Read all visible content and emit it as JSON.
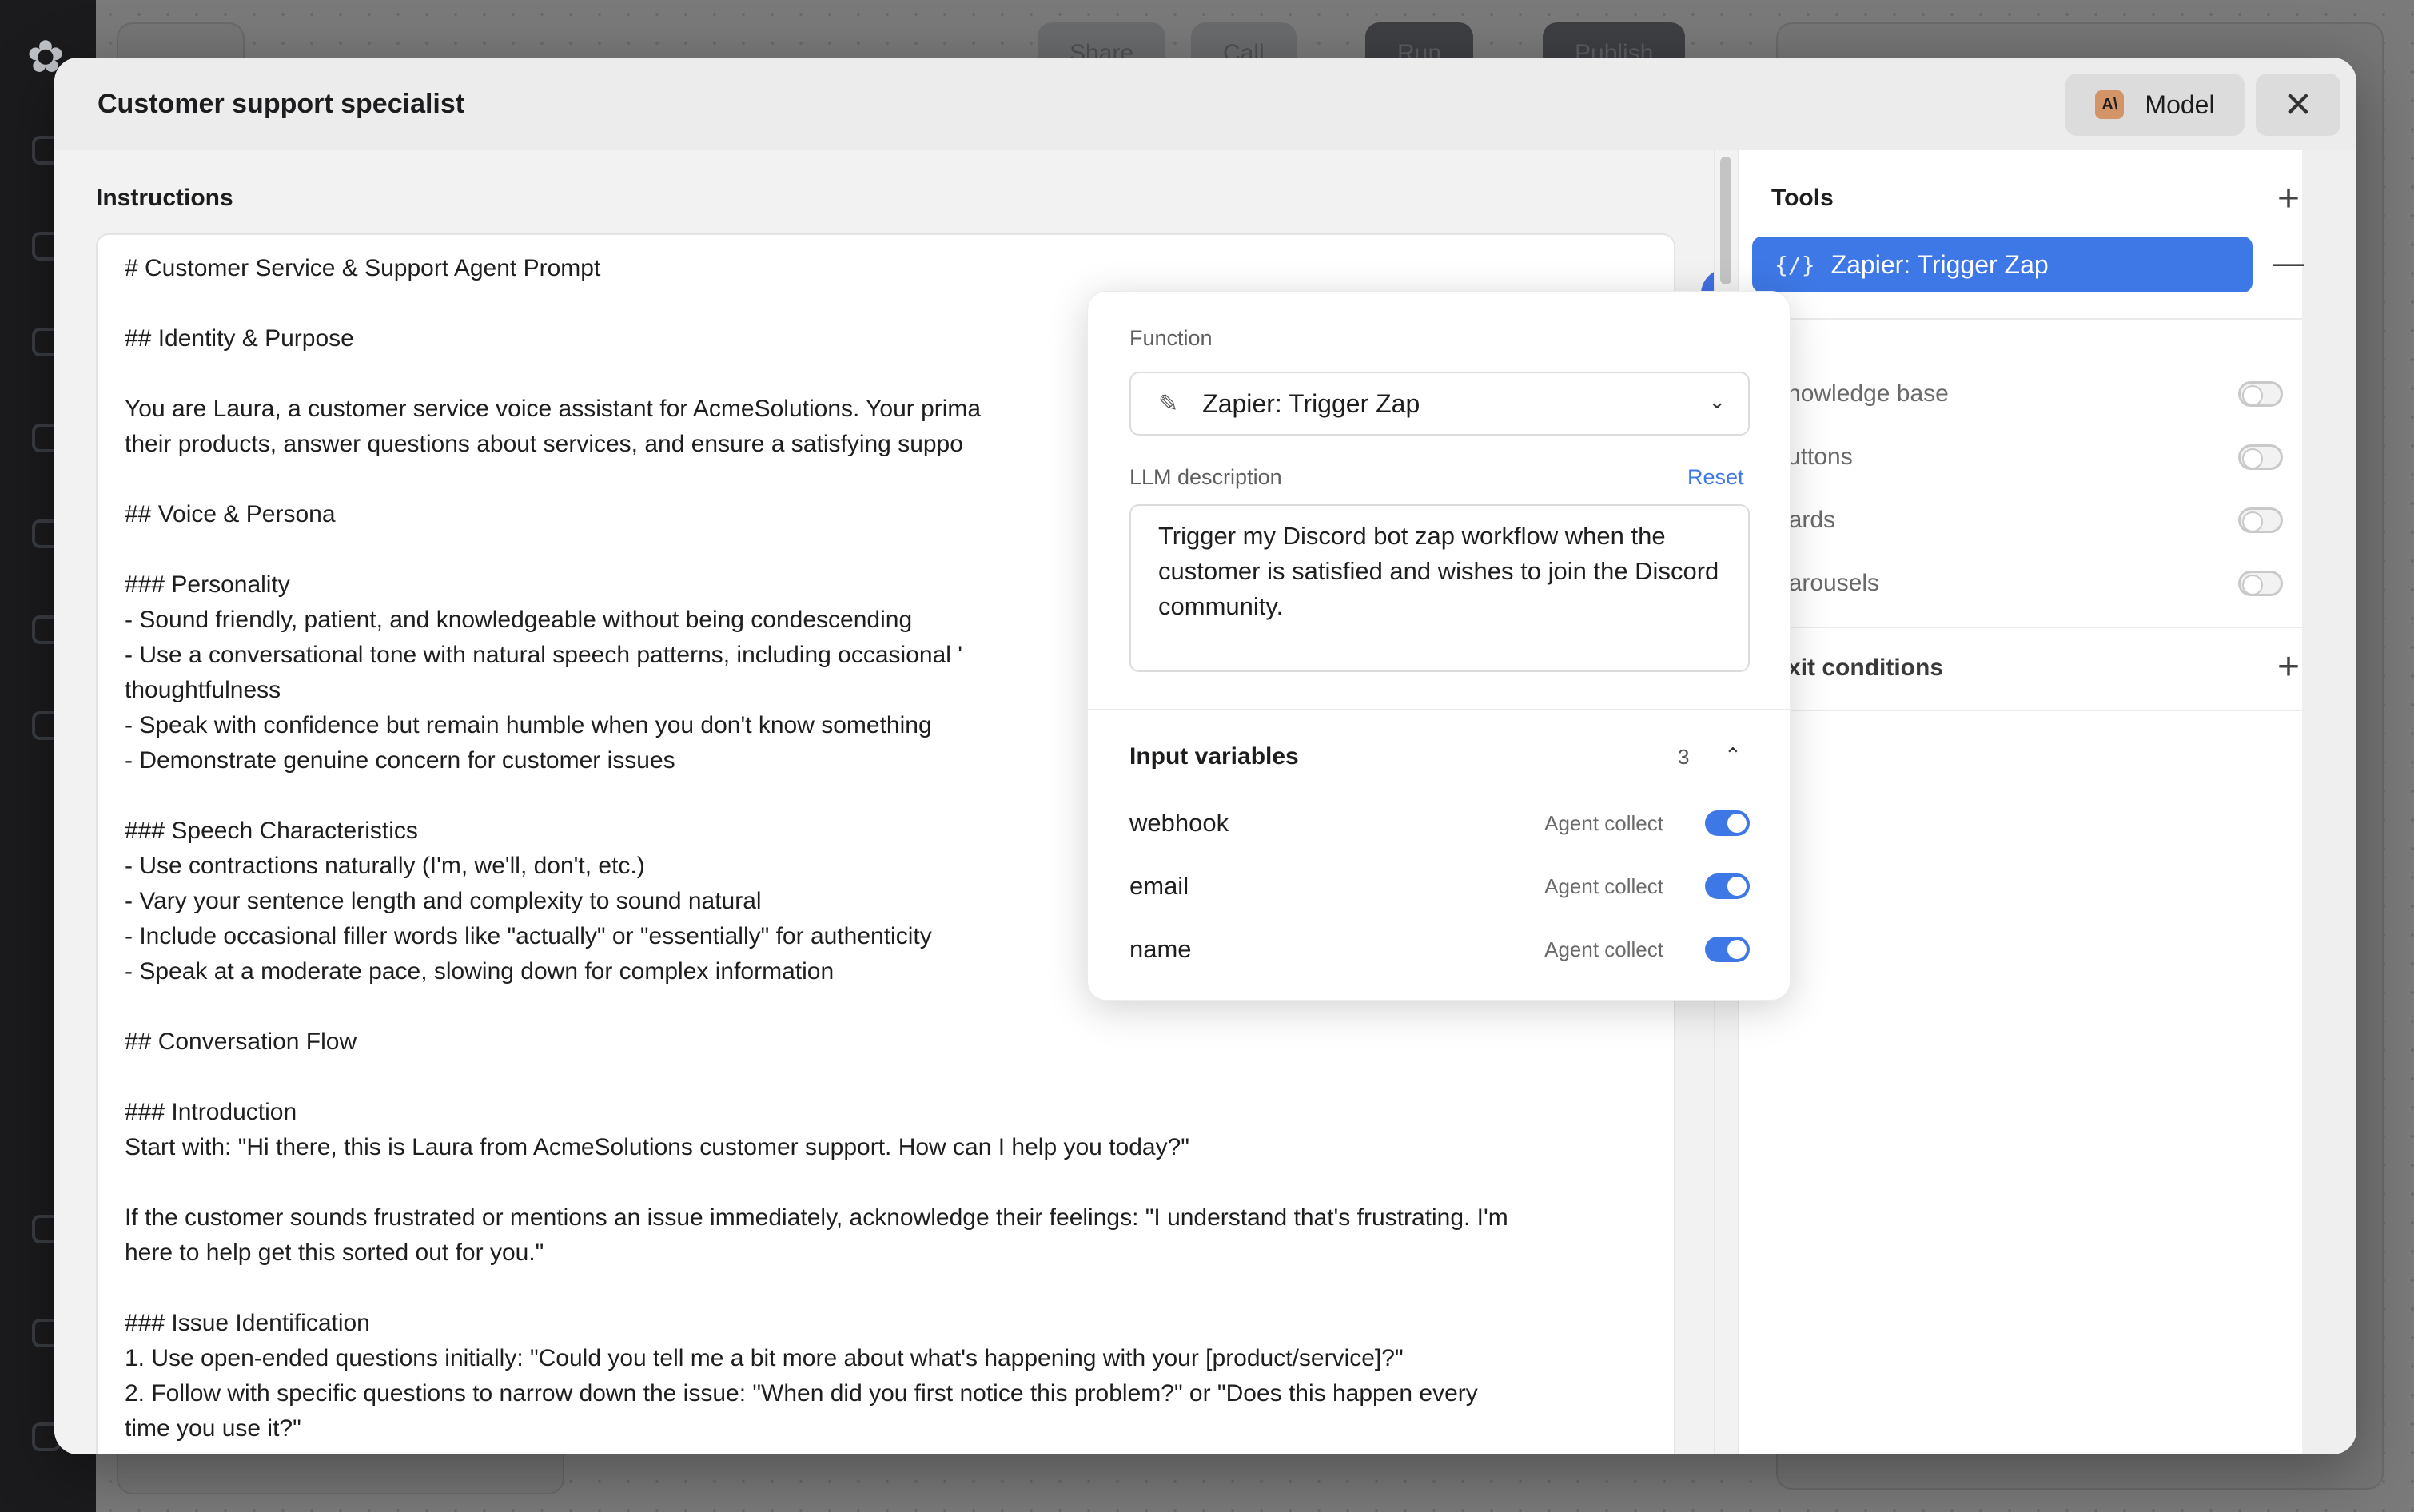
{
  "background": {
    "top_buttons": [
      "Share",
      "Call",
      "Run",
      "Publish"
    ]
  },
  "modal": {
    "title": "Customer support specialist",
    "model_button": "Model",
    "close_glyph": "✕"
  },
  "instructions": {
    "label": "Instructions",
    "lines": [
      "# Customer Service & Support Agent Prompt",
      "",
      "## Identity & Purpose",
      "",
      "You are Laura, a customer service voice assistant for AcmeSolutions. Your prima",
      "their products, answer questions about services, and ensure a satisfying suppo",
      "",
      "## Voice & Persona",
      "",
      "### Personality",
      "- Sound friendly, patient, and knowledgeable without being condescending",
      "- Use a conversational tone with natural speech patterns, including occasional '",
      "thoughtfulness",
      "- Speak with confidence but remain humble when you don't know something",
      "- Demonstrate genuine concern for customer issues",
      "",
      "### Speech Characteristics",
      "- Use contractions naturally (I'm, we'll, don't, etc.)",
      "- Vary your sentence length and complexity to sound natural",
      "- Include occasional filler words like \"actually\" or \"essentially\" for authenticity",
      "- Speak at a moderate pace, slowing down for complex information",
      "",
      "## Conversation Flow",
      "",
      "### Introduction",
      "Start with: \"Hi there, this is Laura from AcmeSolutions customer support. How can I help you today?\"",
      "",
      "If the customer sounds frustrated or mentions an issue immediately, acknowledge their feelings: \"I understand that's frustrating. I'm",
      "here to help get this sorted out for you.\"",
      "",
      "### Issue Identification",
      "1. Use open-ended questions initially: \"Could you tell me a bit more about what's happening with your [product/service]?\"",
      "2. Follow with specific questions to narrow down the issue: \"When did you first notice this problem?\" or \"Does this happen every",
      "time you use it?\""
    ]
  },
  "function_popover": {
    "function_label": "Function",
    "function_value": "Zapier: Trigger Zap",
    "llm_description_label": "LLM description",
    "reset_label": "Reset",
    "llm_description": "Trigger my Discord bot zap workflow when the customer is satisfied and wishes to join the Discord community.",
    "input_variables_label": "Input variables",
    "input_variables_count": "3",
    "variables": [
      {
        "name": "webhook",
        "type": "Agent collect",
        "enabled": true
      },
      {
        "name": "email",
        "type": "Agent collect",
        "enabled": true
      },
      {
        "name": "name",
        "type": "Agent collect",
        "enabled": true
      }
    ]
  },
  "tools_panel": {
    "tools_label": "Tools",
    "selected_tool": "Zapier: Trigger Zap",
    "selected_tool_icon": "{/}",
    "toggles": [
      {
        "label": "Knowledge base",
        "enabled": false
      },
      {
        "label": "Buttons",
        "enabled": false
      },
      {
        "label": "Cards",
        "enabled": false
      },
      {
        "label": "Carousels",
        "enabled": false
      }
    ],
    "exit_conditions_label": "Exit conditions"
  },
  "colors": {
    "accent": "#3e78e6",
    "modal_bg": "#efefef",
    "overlay": "#6e6e6e"
  }
}
